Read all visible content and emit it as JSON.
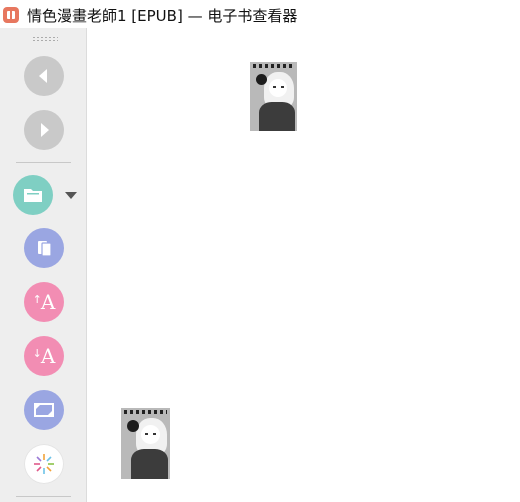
{
  "window": {
    "title": "情色漫畫老師1 [EPUB] — 电子书查看器"
  },
  "toolbar": {
    "buttons": [
      {
        "name": "back",
        "icon": "chevron-left-icon",
        "color": "#c9c9c9"
      },
      {
        "name": "forward",
        "icon": "chevron-right-icon",
        "color": "#c9c9c9"
      },
      {
        "name": "open-book",
        "icon": "folder-icon",
        "color": "#7fcfc3"
      },
      {
        "name": "page-view",
        "icon": "pages-icon",
        "color": "#9aa6e2"
      },
      {
        "name": "font-larger",
        "icon": "font-increase-icon",
        "color": "#f28db3"
      },
      {
        "name": "font-smaller",
        "icon": "font-decrease-icon",
        "color": "#f28db3"
      },
      {
        "name": "fullscreen",
        "icon": "fullscreen-icon",
        "color": "#9aa6e2"
      },
      {
        "name": "controls",
        "icon": "sparkle-icon",
        "color": "#ffffff"
      }
    ],
    "font_glyph": "A"
  },
  "content": {
    "images": [
      {
        "icon": "book-cover-image"
      },
      {
        "icon": "book-cover-image"
      }
    ]
  }
}
